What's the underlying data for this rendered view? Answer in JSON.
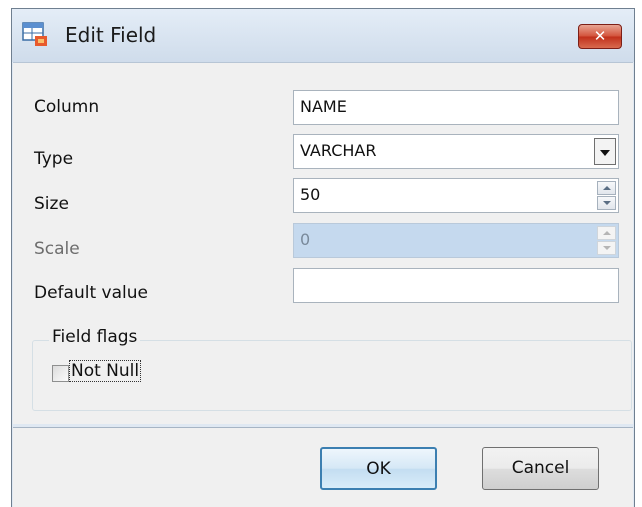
{
  "window": {
    "title": "Edit Field",
    "close_label": "✕"
  },
  "form": {
    "column": {
      "label": "Column",
      "value": "NAME"
    },
    "type": {
      "label": "Type",
      "value": "VARCHAR"
    },
    "size": {
      "label": "Size",
      "value": "50"
    },
    "scale": {
      "label": "Scale",
      "value": "0"
    },
    "default_value": {
      "label": "Default value",
      "value": ""
    }
  },
  "field_flags": {
    "title": "Field flags",
    "not_null": {
      "label": "Not Null",
      "checked": false
    }
  },
  "buttons": {
    "ok": "OK",
    "cancel": "Cancel"
  },
  "colors": {
    "accent": "#3c7fb1",
    "close": "#c1301b",
    "disabled_field": "#c5d9ee"
  }
}
